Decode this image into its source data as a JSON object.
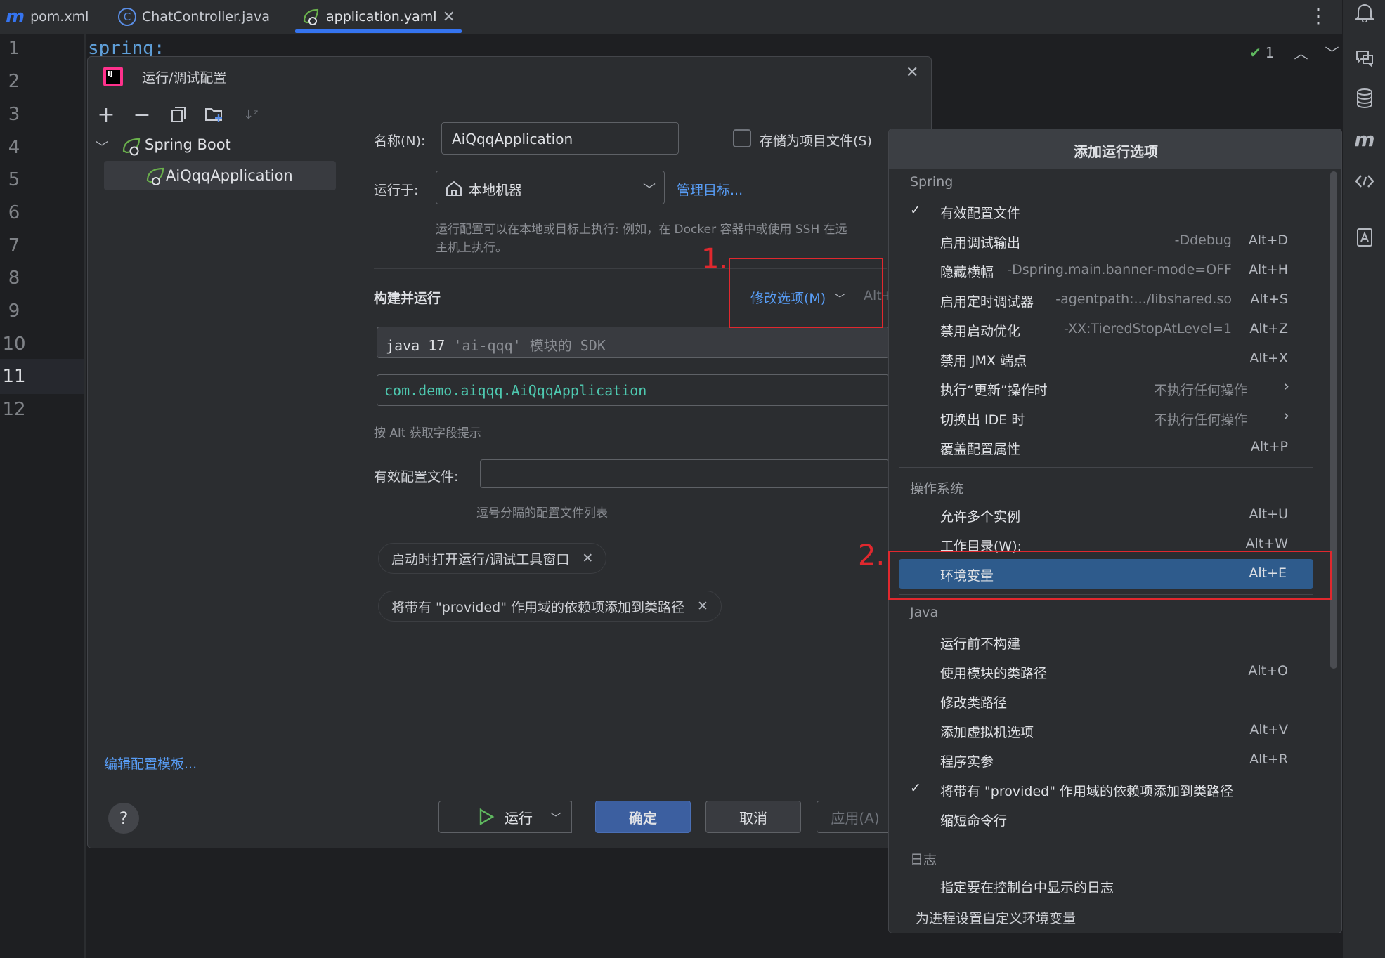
{
  "tabs": [
    {
      "icon": "m",
      "label": "pom.xml"
    },
    {
      "icon": "C",
      "label": "ChatController.java"
    },
    {
      "icon": "spring",
      "label": "application.yaml",
      "active": true
    }
  ],
  "editor": {
    "line_numbers": [
      "1",
      "2",
      "3",
      "4",
      "5",
      "6",
      "7",
      "8",
      "9",
      "10",
      "11",
      "12"
    ],
    "code_line_1": "spring:",
    "inspection_count": "1"
  },
  "dialog": {
    "title": "运行/调试配置",
    "tree": {
      "group": "Spring Boot",
      "item": "AiQqqApplication"
    },
    "name_label": "名称(N):",
    "name_value": "AiQqqApplication",
    "store_as_project_file": "存储为项目文件(S)",
    "run_on_label": "运行于:",
    "run_on_value": "本地机器",
    "manage_targets": "管理目标...",
    "run_on_hint_1": "运行配置可以在本地或目标上执行: 例如，在 Docker 容器中或使用 SSH 在远",
    "run_on_hint_2": "主机上执行。",
    "build_run_title": "构建并运行",
    "modify_options": "修改选项(M)",
    "modify_shortcut": "Alt+",
    "sdk_main": "java 17",
    "sdk_module": "'ai-qqq'",
    "sdk_suffix": "模块的 SDK",
    "main_class": "com.demo.aiqqq.AiQqqApplication",
    "alt_hint": "按 Alt 获取字段提示",
    "profiles_label": "有效配置文件:",
    "profiles_hint": "逗号分隔的配置文件列表",
    "chip_1": "启动时打开运行/调试工具窗口",
    "chip_2": "将带有 \"provided\" 作用域的依赖项添加到类路径",
    "edit_templates": "编辑配置模板...",
    "help": "?",
    "run_button": "运行",
    "ok_button": "确定",
    "cancel_button": "取消",
    "apply_button": "应用(A)"
  },
  "annotations": {
    "step_1": "1.",
    "step_2": "2."
  },
  "popup": {
    "title": "添加运行选项",
    "section_spring": "Spring",
    "spring_items": [
      {
        "label": "有效配置文件",
        "checked": true,
        "hint": "",
        "shortcut": ""
      },
      {
        "label": "启用调试输出",
        "hint": "-Ddebug",
        "shortcut": "Alt+D"
      },
      {
        "label": "隐藏横幅",
        "hint": "-Dspring.main.banner-mode=OFF",
        "shortcut": "Alt+H"
      },
      {
        "label": "启用定时调试器",
        "hint": "-agentpath:.../libshared.so",
        "shortcut": "Alt+S"
      },
      {
        "label": "禁用启动优化",
        "hint": "-XX:TieredStopAtLevel=1",
        "shortcut": "Alt+Z"
      },
      {
        "label": "禁用 JMX 端点",
        "hint": "",
        "shortcut": "Alt+X"
      },
      {
        "label": "执行“更新”操作时",
        "hint2": "不执行任何操作",
        "submenu": true
      },
      {
        "label": "切换出 IDE 时",
        "hint2": "不执行任何操作",
        "submenu": true
      },
      {
        "label": "覆盖配置属性",
        "hint": "",
        "shortcut": "Alt+P"
      }
    ],
    "section_os": "操作系统",
    "os_items": [
      {
        "label": "允许多个实例",
        "shortcut": "Alt+U"
      },
      {
        "label": "工作目录(W):",
        "shortcut": "Alt+W"
      },
      {
        "label": "环境变量",
        "shortcut": "Alt+E",
        "selected": true
      }
    ],
    "section_java": "Java",
    "java_items": [
      {
        "label": "运行前不构建",
        "shortcut": ""
      },
      {
        "label": "使用模块的类路径",
        "shortcut": "Alt+O"
      },
      {
        "label": "修改类路径",
        "shortcut": ""
      },
      {
        "label": "添加虚拟机选项",
        "shortcut": "Alt+V"
      },
      {
        "label": "程序实参",
        "shortcut": "Alt+R"
      },
      {
        "label": "将带有 \"provided\" 作用域的依赖项添加到类路径",
        "checked": true,
        "shortcut": ""
      },
      {
        "label": "缩短命令行",
        "shortcut": ""
      }
    ],
    "section_log": "日志",
    "log_items": [
      {
        "label": "指定要在控制台中显示的日志"
      }
    ],
    "footer": "为进程设置自定义环境变量"
  },
  "colors": {
    "accent": "#3574f0",
    "link": "#589df6",
    "selection": "#2e5b8c",
    "annotation_red": "#e0282e",
    "ok_button": "#3c5fa0"
  }
}
